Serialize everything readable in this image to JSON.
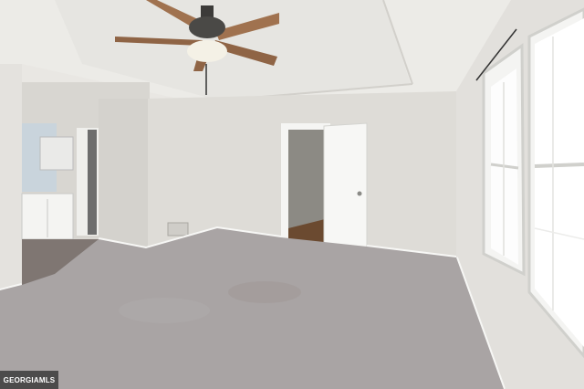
{
  "photo": {
    "description_icons": {
      "ceiling_fan": "ceiling-fan-icon",
      "window": "window-icon",
      "door": "door-icon"
    },
    "colors": {
      "wall": "#dedcd7",
      "ceiling": "#ecebe7",
      "carpet": "#a9a4a4",
      "trim": "#f5f5f3",
      "fan_blade": "#a0724f",
      "hallway_floor": "#6b4a30"
    }
  },
  "watermark": {
    "text": "GEORGIAMLS"
  }
}
